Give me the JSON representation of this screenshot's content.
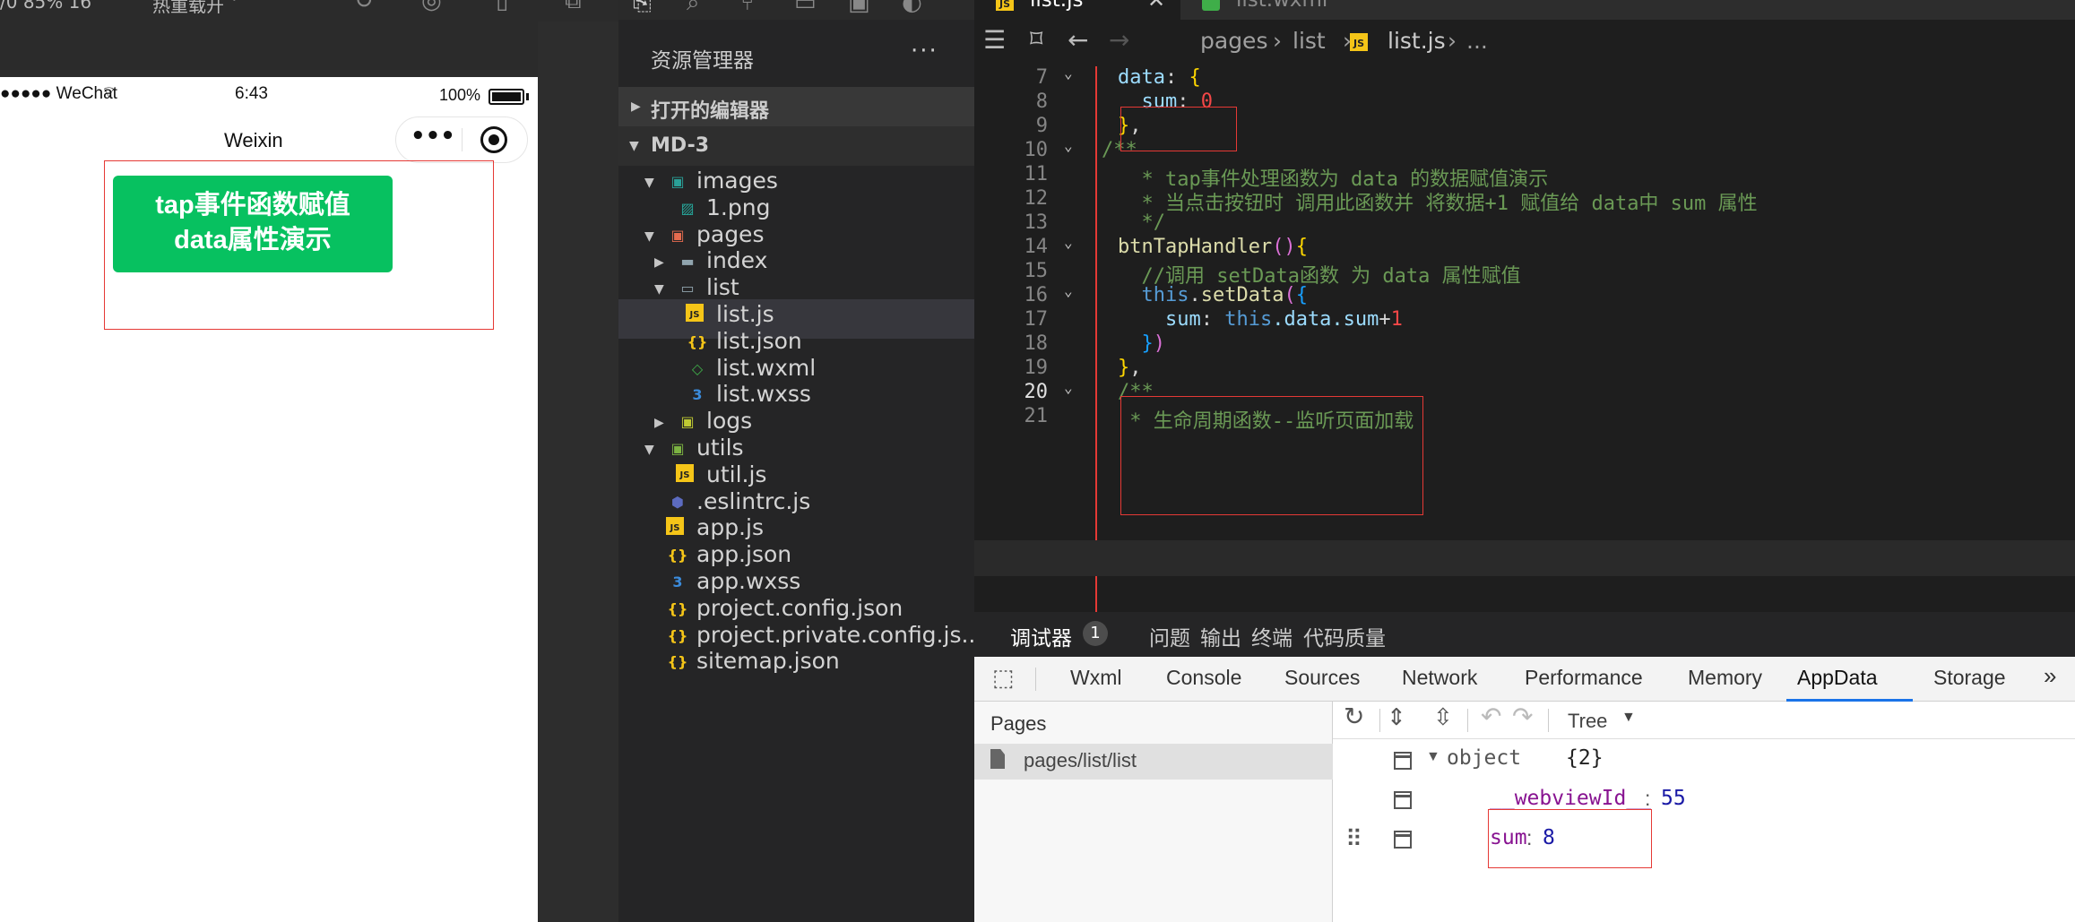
{
  "simulator": {
    "top_text_1": "/0 85% 16 ˇ",
    "top_text_2": "热重载开 ˇ",
    "status": {
      "carrier": "●●●●● WeChat",
      "time": "6:43",
      "battery": "100%"
    },
    "nav_title": "Weixin",
    "capsule_more": "•••",
    "tap_button_line1": "tap事件函数赋值",
    "tap_button_line2": "data属性演示"
  },
  "explorer": {
    "title": "资源管理器",
    "more": "···",
    "open_editors": "打开的编辑器",
    "project": "MD-3",
    "items": [
      {
        "label": "images",
        "icon": "images-folder-icon",
        "depth": 1,
        "caret": "open"
      },
      {
        "label": "1.png",
        "icon": "image-file-icon",
        "depth": 2,
        "caret": ""
      },
      {
        "label": "pages",
        "icon": "pages-folder-icon",
        "depth": 1,
        "caret": "open"
      },
      {
        "label": "index",
        "icon": "folder-icon",
        "depth": 2,
        "caret": "closed"
      },
      {
        "label": "list",
        "icon": "folder-open-icon",
        "depth": 2,
        "caret": "open"
      },
      {
        "label": "list.js",
        "icon": "js-file-icon",
        "depth": 3,
        "caret": "",
        "selected": true
      },
      {
        "label": "list.json",
        "icon": "json-file-icon",
        "depth": 3,
        "caret": ""
      },
      {
        "label": "list.wxml",
        "icon": "wxml-file-icon",
        "depth": 3,
        "caret": ""
      },
      {
        "label": "list.wxss",
        "icon": "wxss-file-icon",
        "depth": 3,
        "caret": ""
      },
      {
        "label": "logs",
        "icon": "logs-folder-icon",
        "depth": 2,
        "caret": "closed"
      },
      {
        "label": "utils",
        "icon": "utils-folder-icon",
        "depth": 1,
        "caret": "open"
      },
      {
        "label": "util.js",
        "icon": "js-file-icon",
        "depth": 2,
        "caret": ""
      },
      {
        "label": ".eslintrc.js",
        "icon": "eslint-file-icon",
        "depth": 1,
        "caret": ""
      },
      {
        "label": "app.js",
        "icon": "js-file-icon",
        "depth": 1,
        "caret": ""
      },
      {
        "label": "app.json",
        "icon": "json-file-icon",
        "depth": 1,
        "caret": ""
      },
      {
        "label": "app.wxss",
        "icon": "wxss-file-icon",
        "depth": 1,
        "caret": ""
      },
      {
        "label": "project.config.json",
        "icon": "json-file-icon",
        "depth": 1,
        "caret": ""
      },
      {
        "label": "project.private.config.js...",
        "icon": "json-file-icon",
        "depth": 1,
        "caret": ""
      },
      {
        "label": "sitemap.json",
        "icon": "json-file-icon",
        "depth": 1,
        "caret": ""
      }
    ]
  },
  "editor": {
    "tabs": [
      "list.js",
      "list.wxml"
    ],
    "breadcrumb": [
      "pages",
      "list",
      "list.js",
      "..."
    ],
    "lines": [
      {
        "n": "7",
        "fold": true,
        "tokens": [
          [
            "data",
            "#9cdcfe"
          ],
          [
            ": ",
            "#d4d4d4"
          ],
          [
            "{",
            "#ffd700"
          ]
        ]
      },
      {
        "n": "8",
        "fold": false,
        "tokens": [
          [
            "  sum",
            "#9cdcfe"
          ],
          [
            ": ",
            "#d4d4d4"
          ],
          [
            "0",
            "#f44747"
          ]
        ]
      },
      {
        "n": "9",
        "fold": false,
        "tokens": [
          [
            "}",
            "#ffd700"
          ],
          [
            ",",
            "#d4d4d4"
          ]
        ]
      },
      {
        "n": "10",
        "fold": true,
        "tokens": [
          [
            "/**",
            "#6a9955"
          ]
        ]
      },
      {
        "n": "11",
        "fold": false,
        "tokens": [
          [
            "  * tap事件处理函数为 data 的数据赋值演示",
            "#6a9955"
          ]
        ]
      },
      {
        "n": "12",
        "fold": false,
        "tokens": [
          [
            "  * 当点击按钮时 调用此函数并 将数据+1 赋值给 data中 sum 属性",
            "#6a9955"
          ]
        ]
      },
      {
        "n": "13",
        "fold": false,
        "tokens": [
          [
            "  */",
            "#6a9955"
          ]
        ]
      },
      {
        "n": "14",
        "fold": true,
        "tokens": [
          [
            "btnTapHandler",
            "#dcdcaa"
          ],
          [
            "()",
            "#da70d6"
          ],
          [
            "{",
            "#ffd700"
          ]
        ]
      },
      {
        "n": "15",
        "fold": false,
        "tokens": [
          [
            "  //调用 setData函数 为 data 属性赋值",
            "#6a9955"
          ]
        ]
      },
      {
        "n": "16",
        "fold": true,
        "tokens": [
          [
            "  this",
            "#569cd6"
          ],
          [
            ".",
            "#d4d4d4"
          ],
          [
            "setData",
            "#dcdcaa"
          ],
          [
            "(",
            "#da70d6"
          ],
          [
            "{",
            "#179fff"
          ]
        ]
      },
      {
        "n": "17",
        "fold": false,
        "tokens": [
          [
            "    sum",
            "#9cdcfe"
          ],
          [
            ": ",
            "#d4d4d4"
          ],
          [
            "this",
            "#569cd6"
          ],
          [
            ".data.sum",
            "#9cdcfe"
          ],
          [
            "+",
            "#d4d4d4"
          ],
          [
            "1",
            "#f44747"
          ]
        ]
      },
      {
        "n": "18",
        "fold": false,
        "tokens": [
          [
            "  }",
            "#179fff"
          ],
          [
            ")",
            "#da70d6"
          ]
        ]
      },
      {
        "n": "19",
        "fold": false,
        "tokens": [
          [
            "}",
            "#ffd700"
          ],
          [
            ",",
            "#d4d4d4"
          ]
        ]
      },
      {
        "n": "20",
        "fold": true,
        "tokens": [
          [
            "/**",
            "#6a9955"
          ]
        ]
      },
      {
        "n": "21",
        "fold": false,
        "tokens": [
          [
            " * 生命周期函数--监听页面加载",
            "#6a9955"
          ]
        ]
      }
    ]
  },
  "debugger": {
    "tabs": [
      {
        "label": "调试器"
      },
      {
        "label": "问题"
      },
      {
        "label": "输出"
      },
      {
        "label": "终端"
      },
      {
        "label": "代码质量"
      }
    ],
    "badge": "1",
    "devtools_tabs": [
      "Wxml",
      "Console",
      "Sources",
      "Network",
      "Performance",
      "Memory",
      "AppData",
      "Storage"
    ],
    "active_devtool": "AppData",
    "more": "»",
    "pages_header": "Pages",
    "pages_item": "pages/list/list",
    "view_mode": "Tree",
    "tree": {
      "root": "object",
      "root_count": "{2}",
      "entries": [
        {
          "key": "__webviewId__",
          "value": "55"
        },
        {
          "key": "sum",
          "value": "8"
        }
      ]
    }
  }
}
